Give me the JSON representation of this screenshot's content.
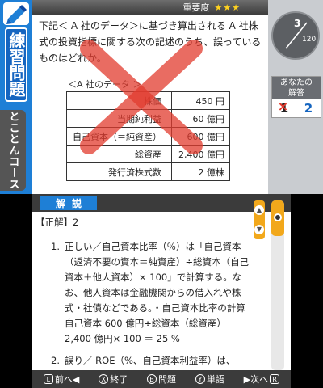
{
  "top": {
    "logo_icon": "pencil-book-icon",
    "mode_title": "練習問題",
    "course_tab": "とことんコース",
    "importance_label": "重要度",
    "importance_stars": "★★★",
    "question_text": "下記＜ A 社のデータ＞に基づき算出される A 社株式の投資指標に関する次の記述のうち、誤っているものはどれか。",
    "data_caption": "＜A 社のデータ ＞",
    "table": [
      {
        "key": "株価",
        "value": "450 円"
      },
      {
        "key": "当期純利益",
        "value": "60 億円"
      },
      {
        "key": "自己資本（＝純資産）",
        "value": "600 億円"
      },
      {
        "key": "総資産",
        "value": "2,400 億円"
      },
      {
        "key": "発行済株式数",
        "value": "2 億株"
      }
    ],
    "result_mark": "incorrect-cross",
    "counter": {
      "current": "3",
      "total": "120",
      "progress": 0.025
    },
    "answer_label_line1": "あなたの",
    "answer_label_line2": "解答",
    "user_answer": "1",
    "user_answer_mark": "×",
    "correct_answer": "2"
  },
  "bottom": {
    "explain_title": "解説",
    "correct_line": "【正解】2",
    "items": [
      {
        "num": "1.",
        "text": "正しい／自己資本比率（％）は「自己資本（返済不要の資本＝純資産）÷総資本（自己資本＋他人資本）× 100」で計算する。なお、他人資本は金融機関からの借入れや株式・社債などである。・自己資本比率の計算自己資本 600 億円÷総資本（総資産）2,400 億円× 100 ＝ 25 %"
      },
      {
        "num": "2.",
        "text": "誤り／ ROE（%、自己資本利益率）は、"
      }
    ],
    "scroll_up": "▲",
    "scroll_down": "▼",
    "toolbar": [
      {
        "key": "L",
        "label": "前へ◀",
        "round": false
      },
      {
        "key": "X",
        "label": "終了",
        "round": true
      },
      {
        "key": "B",
        "label": "問題",
        "round": true
      },
      {
        "key": "Y",
        "label": "単語",
        "round": true
      },
      {
        "key": "R",
        "label": "▶次へ",
        "round": false,
        "key_after": true
      }
    ]
  },
  "colors": {
    "accent": "#1e7fd6",
    "orange": "#f2a81b",
    "cross": "#e23b2e"
  }
}
